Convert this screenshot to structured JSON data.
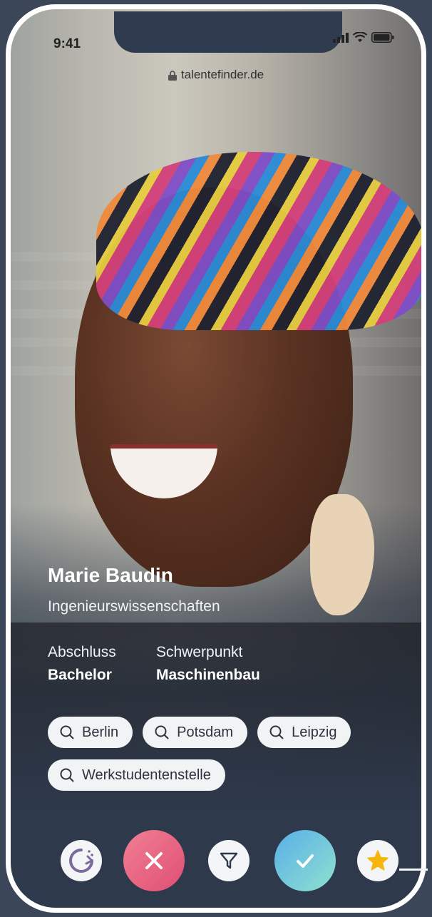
{
  "status_bar": {
    "time": "9:41"
  },
  "browser": {
    "url": "talentefinder.de"
  },
  "profile": {
    "name": "Marie Baudin",
    "field": "Ingenieurswissenschaften",
    "degree_label": "Abschluss",
    "degree_value": "Bachelor",
    "focus_label": "Schwerpunkt",
    "focus_value": "Maschinenbau"
  },
  "chips": [
    "Berlin",
    "Potsdam",
    "Leipzig",
    "Werkstudentenstelle"
  ],
  "actions": {
    "undo_icon": "undo-icon",
    "reject_icon": "close-icon",
    "filter_icon": "filter-icon",
    "accept_icon": "check-icon",
    "favorite_icon": "star-icon"
  },
  "colors": {
    "reject_gradient": [
      "#f07f93",
      "#e04f74"
    ],
    "accept_gradient": [
      "#59b0e8",
      "#8fe0cf"
    ],
    "star": "#f5b50a",
    "undo_accent": "#7a6a9e"
  }
}
